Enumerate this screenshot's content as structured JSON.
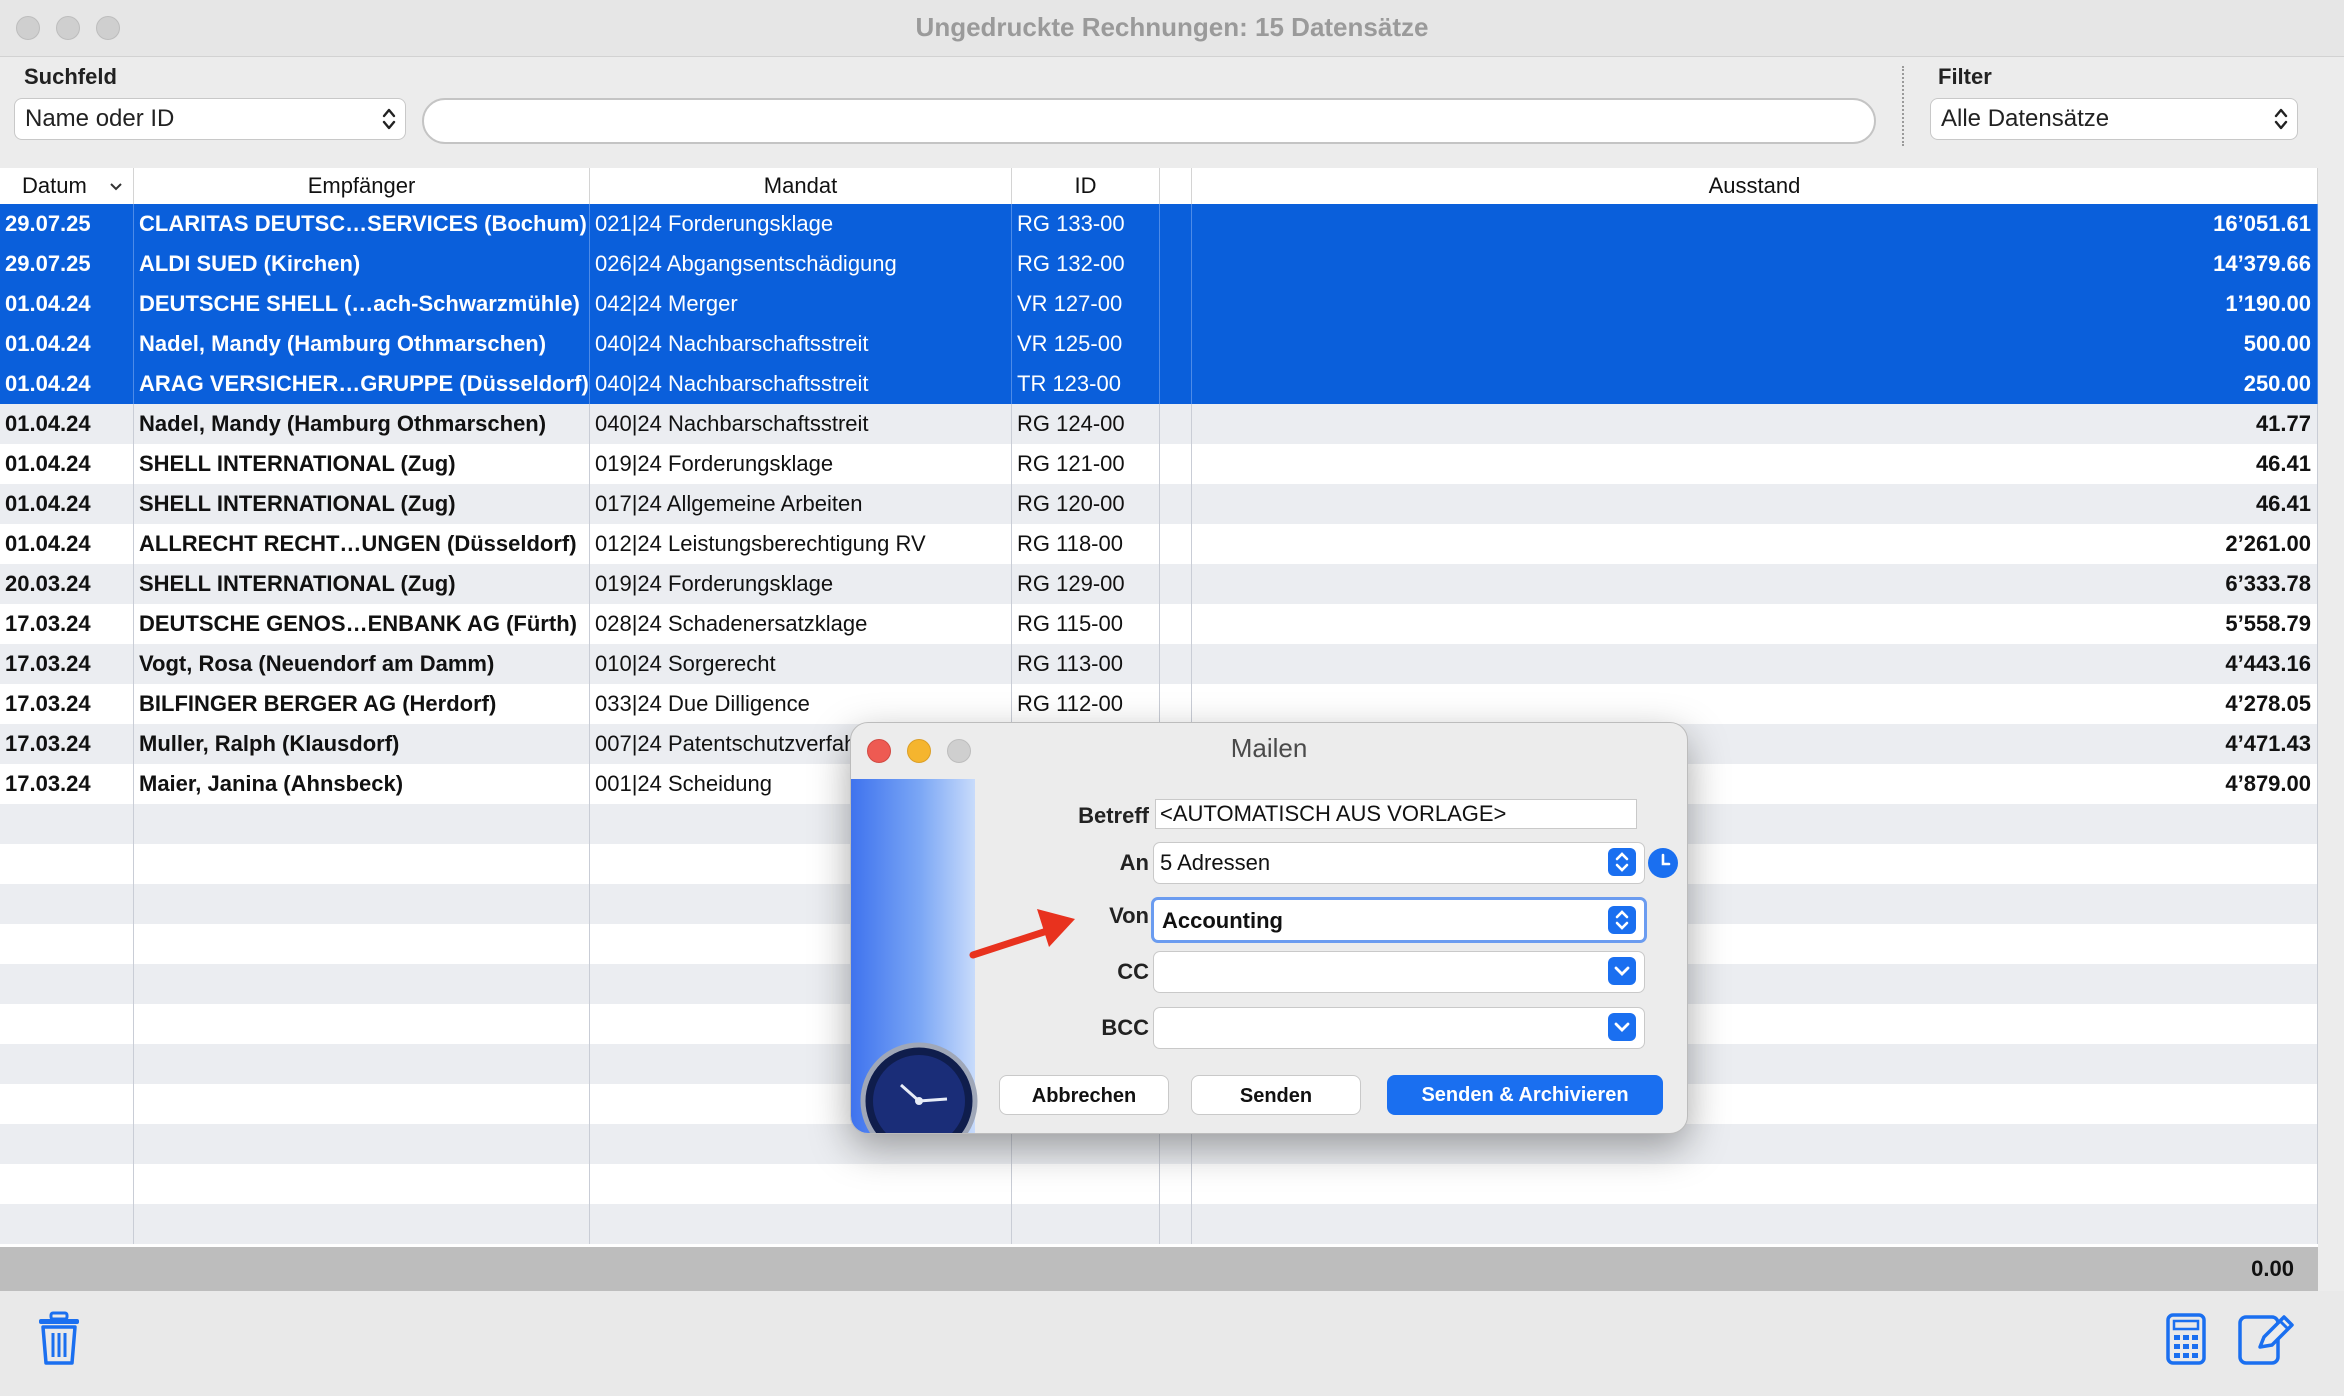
{
  "window": {
    "title": "Ungedruckte Rechnungen: 15 Datensätze"
  },
  "search": {
    "label": "Suchfeld",
    "field_select": "Name oder ID",
    "query": ""
  },
  "filter": {
    "label": "Filter",
    "value": "Alle Datensätze"
  },
  "table": {
    "columns": [
      "Datum",
      "Empfänger",
      "Mandat",
      "ID",
      "",
      "Ausstand"
    ],
    "rows": [
      {
        "date": "29.07.25",
        "recipient": "CLARITAS DEUTSC…SERVICES (Bochum)",
        "mandate": "021|24 Forderungsklage",
        "id": "RG 133-00",
        "amount": "16’051.61",
        "selected": true
      },
      {
        "date": "29.07.25",
        "recipient": "ALDI SUED (Kirchen)",
        "mandate": "026|24 Abgangsentschädigung",
        "id": "RG 132-00",
        "amount": "14’379.66",
        "selected": true
      },
      {
        "date": "01.04.24",
        "recipient": "DEUTSCHE SHELL (…ach-Schwarzmühle)",
        "mandate": "042|24 Merger",
        "id": "VR 127-00",
        "amount": "1’190.00",
        "selected": true
      },
      {
        "date": "01.04.24",
        "recipient": "Nadel, Mandy (Hamburg Othmarschen)",
        "mandate": "040|24 Nachbarschaftsstreit",
        "id": "VR 125-00",
        "amount": "500.00",
        "selected": true
      },
      {
        "date": "01.04.24",
        "recipient": "ARAG VERSICHER…GRUPPE (Düsseldorf)",
        "mandate": "040|24 Nachbarschaftsstreit",
        "id": "TR 123-00",
        "amount": "250.00",
        "selected": true
      },
      {
        "date": "01.04.24",
        "recipient": "Nadel, Mandy (Hamburg Othmarschen)",
        "mandate": "040|24 Nachbarschaftsstreit",
        "id": "RG 124-00",
        "amount": "41.77",
        "selected": false
      },
      {
        "date": "01.04.24",
        "recipient": "SHELL INTERNATIONAL (Zug)",
        "mandate": "019|24 Forderungsklage",
        "id": "RG 121-00",
        "amount": "46.41",
        "selected": false
      },
      {
        "date": "01.04.24",
        "recipient": "SHELL INTERNATIONAL (Zug)",
        "mandate": "017|24 Allgemeine Arbeiten",
        "id": "RG 120-00",
        "amount": "46.41",
        "selected": false
      },
      {
        "date": "01.04.24",
        "recipient": "ALLRECHT RECHT…UNGEN (Düsseldorf)",
        "mandate": "012|24 Leistungsberechtigung RV",
        "id": "RG 118-00",
        "amount": "2’261.00",
        "selected": false
      },
      {
        "date": "20.03.24",
        "recipient": "SHELL INTERNATIONAL (Zug)",
        "mandate": "019|24 Forderungsklage",
        "id": "RG 129-00",
        "amount": "6’333.78",
        "selected": false
      },
      {
        "date": "17.03.24",
        "recipient": "DEUTSCHE GENOS…ENBANK AG (Fürth)",
        "mandate": "028|24 Schadenersatzklage",
        "id": "RG 115-00",
        "amount": "5’558.79",
        "selected": false
      },
      {
        "date": "17.03.24",
        "recipient": "Vogt, Rosa (Neuendorf am Damm)",
        "mandate": "010|24 Sorgerecht",
        "id": "RG 113-00",
        "amount": "4’443.16",
        "selected": false
      },
      {
        "date": "17.03.24",
        "recipient": "BILFINGER BERGER AG (Herdorf)",
        "mandate": "033|24 Due Dilligence",
        "id": "RG 112-00",
        "amount": "4’278.05",
        "selected": false
      },
      {
        "date": "17.03.24",
        "recipient": "Muller, Ralph (Klausdorf)",
        "mandate": "007|24 Patentschutzverfah",
        "id": "",
        "amount": "4’471.43",
        "selected": false
      },
      {
        "date": "17.03.24",
        "recipient": "Maier, Janina (Ahnsbeck)",
        "mandate": "001|24 Scheidung",
        "id": "",
        "amount": "4’879.00",
        "selected": false
      }
    ],
    "total": "0.00"
  },
  "dialog": {
    "title": "Mailen",
    "betreff_label": "Betreff",
    "betreff_value": "<AUTOMATISCH AUS VORLAGE>",
    "an_label": "An",
    "an_value": "5 Adressen",
    "von_label": "Von",
    "von_value": "Accounting",
    "cc_label": "CC",
    "cc_value": "",
    "bcc_label": "BCC",
    "bcc_value": "",
    "cancel": "Abbrechen",
    "send": "Senden",
    "send_archive": "Senden & Archivieren"
  },
  "icons": [
    "trash-icon",
    "calculator-icon",
    "edit-icon",
    "clock-icon",
    "red-arrow-icon"
  ],
  "colors": {
    "selection": "#0a5fdb",
    "accent": "#1a6ff0",
    "arrow": "#e8321e"
  }
}
